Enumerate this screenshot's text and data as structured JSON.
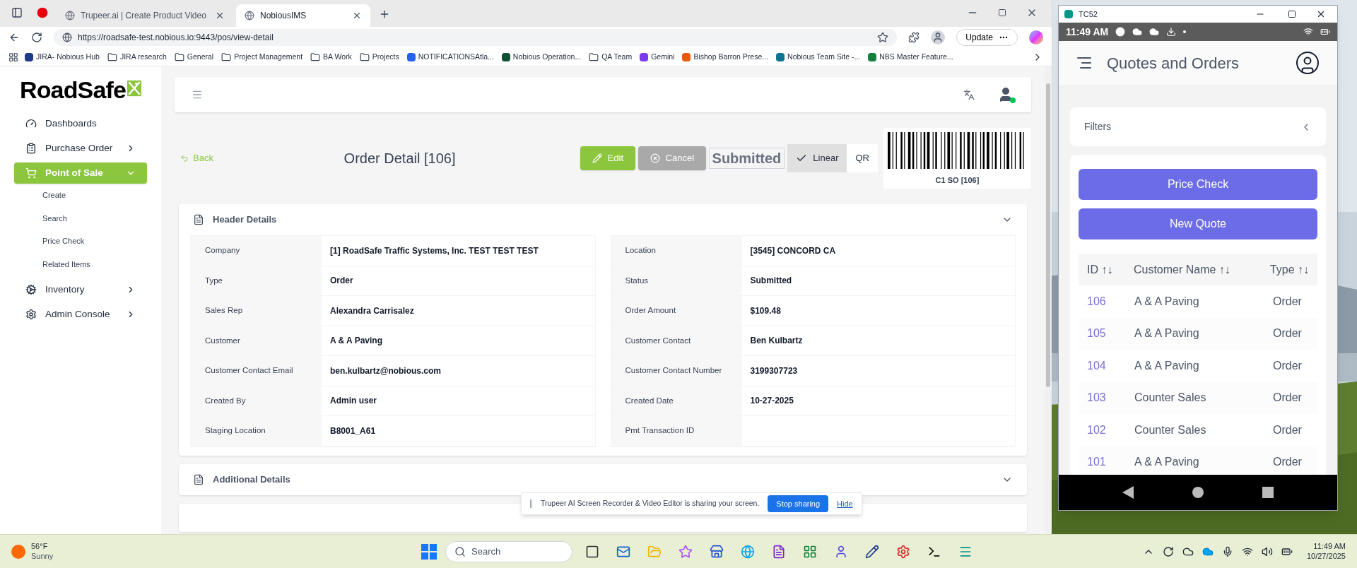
{
  "browser": {
    "tabs": [
      {
        "title": "Trupeer.ai | Create Product Video",
        "selected": false
      },
      {
        "title": "NobiousIMS",
        "selected": true
      }
    ],
    "address": "https://roadsafe-test.nobious.io:9443/pos/view-detail",
    "update_button": "Update",
    "bookmarks": [
      {
        "label": "JIRA- Nobious Hub",
        "kind": "site",
        "color": "#1e3a8a"
      },
      {
        "label": "JIRA research",
        "kind": "folder"
      },
      {
        "label": "General",
        "kind": "folder"
      },
      {
        "label": "Project Management",
        "kind": "folder"
      },
      {
        "label": "BA Work",
        "kind": "folder"
      },
      {
        "label": "Projects",
        "kind": "folder"
      },
      {
        "label": "NOTIFICATIONSAtla...",
        "kind": "site",
        "color": "#2563eb"
      },
      {
        "label": "Nobious Operation...",
        "kind": "site",
        "color": "#0f5132"
      },
      {
        "label": "QA Team",
        "kind": "folder"
      },
      {
        "label": "Gemini",
        "kind": "site",
        "color": "#7c3aed"
      },
      {
        "label": "Bishop Barron Prese...",
        "kind": "site",
        "color": "#ea580c"
      },
      {
        "label": "Nobious Team Site -...",
        "kind": "site",
        "color": "#0e7490"
      },
      {
        "label": "NBS Master Feature...",
        "kind": "site",
        "color": "#15803d"
      }
    ]
  },
  "app": {
    "logo": "RoadSafe",
    "sidebar": [
      {
        "label": "Dashboards",
        "kind": "link",
        "selected": false
      },
      {
        "label": "Purchase Order",
        "kind": "group",
        "selected": false,
        "expanded": false
      },
      {
        "label": "Point of Sale",
        "kind": "group",
        "selected": true,
        "expanded": true,
        "children": [
          {
            "label": "Create"
          },
          {
            "label": "Search"
          },
          {
            "label": "Price Check"
          },
          {
            "label": "Related Items"
          }
        ]
      },
      {
        "label": "Inventory",
        "kind": "group",
        "selected": false,
        "expanded": false
      },
      {
        "label": "Admin Console",
        "kind": "group",
        "selected": false,
        "expanded": false
      }
    ],
    "back": "Back",
    "title": "Order Detail [106]",
    "edit": "Edit",
    "cancel": "Cancel",
    "status": "Submitted",
    "barcode_modes": [
      {
        "label": "Linear",
        "selected": true
      },
      {
        "label": "QR",
        "selected": false
      }
    ],
    "barcode_caption": "C1 SO [106]",
    "sections": [
      {
        "title": "Header Details",
        "expanded": true,
        "left": [
          {
            "label": "Company",
            "value": "[1] RoadSafe Traffic Systems, Inc. TEST TEST TEST"
          },
          {
            "label": "Type",
            "value": "Order"
          },
          {
            "label": "Sales Rep",
            "value": "Alexandra Carrisalez"
          },
          {
            "label": "Customer",
            "value": "A & A Paving"
          },
          {
            "label": "Customer Contact Email",
            "value": "ben.kulbartz@nobious.com"
          },
          {
            "label": "Created By",
            "value": "Admin user"
          },
          {
            "label": "Staging Location",
            "value": "B8001_A61"
          }
        ],
        "right": [
          {
            "label": "Location",
            "value": "[3545] CONCORD CA"
          },
          {
            "label": "Status",
            "value": "Submitted"
          },
          {
            "label": "Order Amount",
            "value": "$109.48"
          },
          {
            "label": "Customer Contact",
            "value": "Ben Kulbartz"
          },
          {
            "label": "Customer Contact Number",
            "value": "3199307723"
          },
          {
            "label": "Created Date",
            "value": "10-27-2025"
          },
          {
            "label": "Pmt Transaction ID"
          }
        ]
      },
      {
        "title": "Additional Details",
        "expanded": false
      }
    ]
  },
  "share_banner": {
    "message": "Trupeer AI Screen Recorder & Video Editor is sharing your screen.",
    "stop": "Stop sharing",
    "hide": "Hide"
  },
  "phone": {
    "title": "TC52",
    "time": "11:49 AM",
    "app_title": "Quotes and Orders",
    "filters": "Filters",
    "buttons": [
      "Price Check",
      "New Quote"
    ],
    "columns": [
      "ID ↑↓",
      "Customer Name ↑↓",
      "Type ↑↓"
    ],
    "rows": [
      {
        "id": "106",
        "customer": "A & A Paving",
        "type": "Order"
      },
      {
        "id": "105",
        "customer": "A & A Paving",
        "type": "Order"
      },
      {
        "id": "104",
        "customer": "A & A Paving",
        "type": "Order"
      },
      {
        "id": "103",
        "customer": "Counter Sales",
        "type": "Order"
      },
      {
        "id": "102",
        "customer": "Counter Sales",
        "type": "Order"
      },
      {
        "id": "101",
        "customer": "A & A Paving",
        "type": "Order"
      }
    ]
  },
  "taskbar": {
    "temp": "56°F",
    "condition": "Sunny",
    "search_placeholder": "Search",
    "time": "11:49 AM",
    "date": "10/27/2025"
  }
}
